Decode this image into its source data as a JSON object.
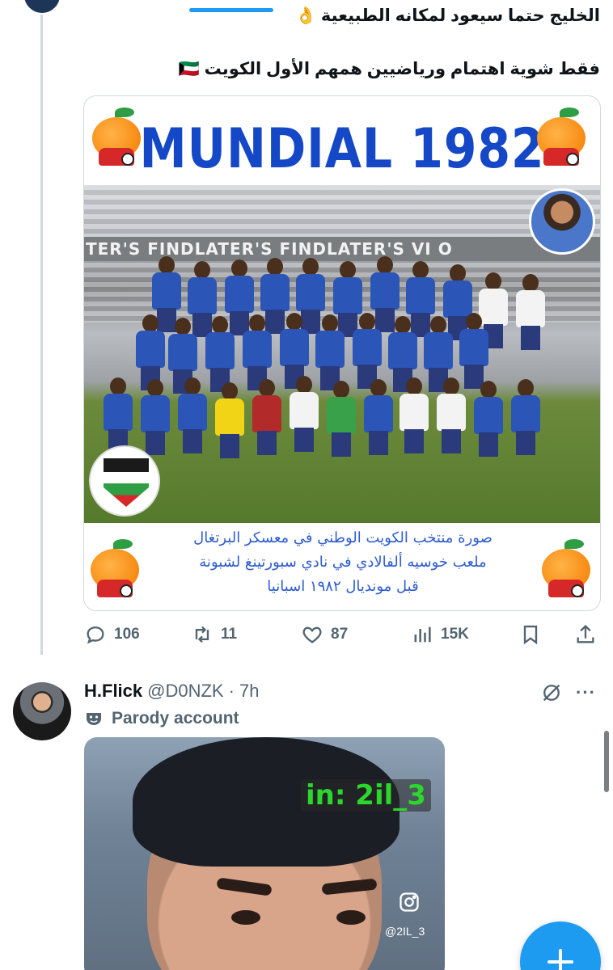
{
  "tweet1": {
    "text_line_1": "الخليج حتما سيعود لمكانه الطبيعية 👌",
    "text_line_2": "فقط شوية اهتمام ورياضيين همهم الأول الكويت 🇰🇼",
    "media": {
      "poster_title": "MUNDIAL 1982",
      "sponsor_board": "TER'S  FINDLATER'S  FINDLATER'S          VI O",
      "caption_line_1": "صورة منتخب الكويت الوطني في معسكر البرتغال",
      "caption_line_2": "ملعب خوسيه ألفالادي في نادي سبورتينغ لشبونة",
      "caption_line_3": "قبل مونديال ١٩٨٢ اسبانيا"
    },
    "actions": {
      "replies": "106",
      "retweets": "11",
      "likes": "87",
      "views": "15K"
    }
  },
  "tweet2": {
    "author_name": "H.Flick",
    "handle": "@D0NZK",
    "time": "· 7h",
    "parody_label": "Parody account",
    "more_label": "···",
    "video": {
      "watermark": "in:  2il_3",
      "instagram_handle": "@2IL_3"
    }
  },
  "colors": {
    "accent": "#1d9bf0",
    "text_primary": "#0f1419",
    "text_secondary": "#536471",
    "poster_blue": "#1548c7"
  },
  "icons": {
    "reply": "reply-icon",
    "retweet": "retweet-icon",
    "like": "heart-icon",
    "views": "views-icon",
    "bookmark": "bookmark-icon",
    "share": "share-icon",
    "grok": "grok-icon",
    "more": "more-icon",
    "parody": "mask-icon",
    "compose": "plus-icon"
  }
}
